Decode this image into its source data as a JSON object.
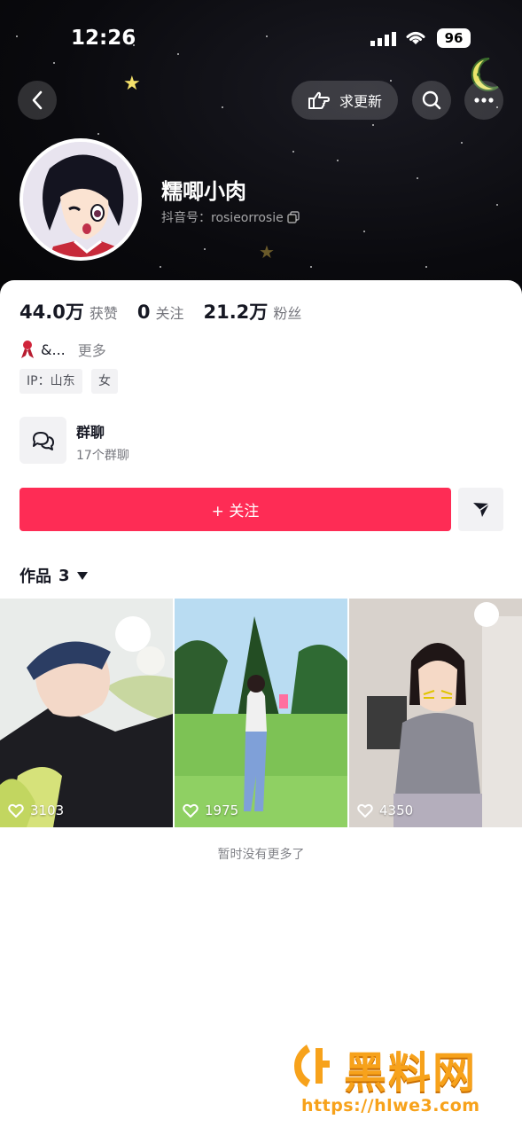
{
  "status_bar": {
    "time": "12:26",
    "battery": "96"
  },
  "nav": {
    "update_label": "求更新"
  },
  "profile": {
    "name": "糯唧小肉",
    "douyin_id": "抖音号：rosieorrosie"
  },
  "stats": [
    {
      "value": "44.0万",
      "label": "获赞"
    },
    {
      "value": "0",
      "label": "关注"
    },
    {
      "value": "21.2万",
      "label": "粉丝"
    }
  ],
  "bio": {
    "text": "&...",
    "more": "更多"
  },
  "tags": [
    "IP：山东",
    "女"
  ],
  "group_chat": {
    "title": "群聊",
    "subtitle": "17个群聊"
  },
  "follow_button": "+ 关注",
  "works_tab": {
    "label": "作品",
    "count": "3"
  },
  "videos": [
    {
      "likes": "3103"
    },
    {
      "likes": "1975"
    },
    {
      "likes": "4350"
    }
  ],
  "no_more": "暂时没有更多了",
  "watermark": {
    "title": "黑料网",
    "url": "https://hlwe3.com"
  },
  "colors": {
    "accent": "#fe2c55",
    "watermark": "#f7a21b"
  }
}
